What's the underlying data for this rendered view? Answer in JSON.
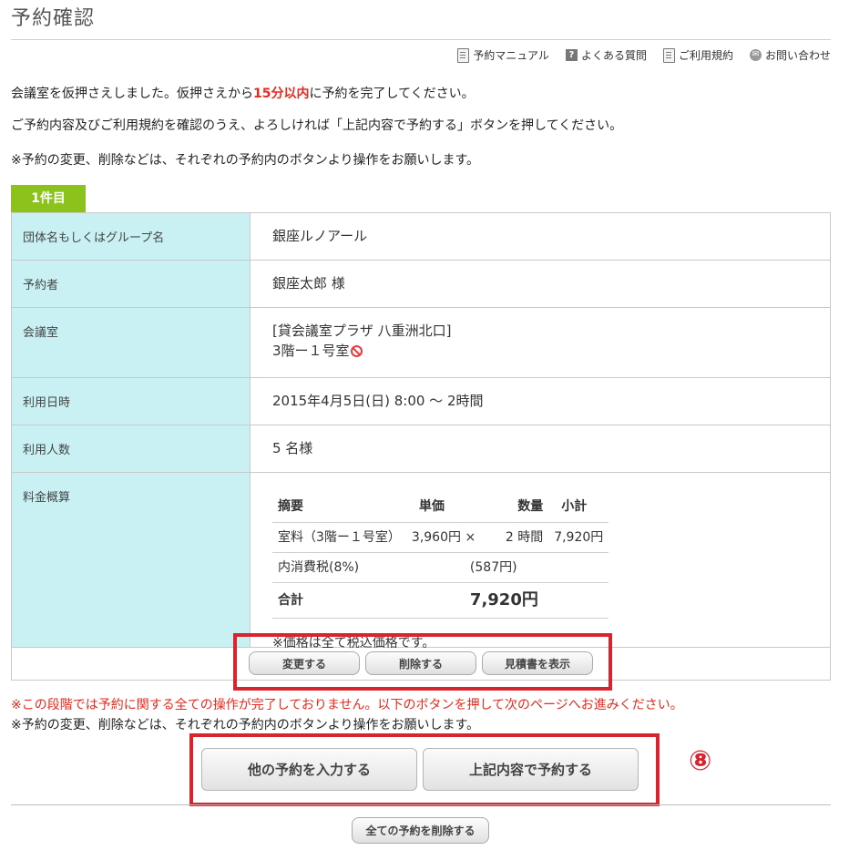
{
  "page_title": "予約確認",
  "help_links": [
    {
      "label": "予約マニュアル",
      "icon": "document-icon"
    },
    {
      "label": "よくある質問",
      "icon": "question-icon"
    },
    {
      "label": "ご利用規約",
      "icon": "document-icon"
    },
    {
      "label": "お問い合わせ",
      "icon": "mail-icon"
    }
  ],
  "messages": {
    "line1_a": "会議室を仮押さえしました。仮押さえから",
    "line1_em": "15分以内",
    "line1_b": "に予約を完了してください。",
    "line2": "ご予約内容及びご利用規約を確認のうえ、よろしければ「上記内容で予約する」ボタンを押してください。",
    "line3": "※予約の変更、削除などは、それぞれの予約内のボタンより操作をお願いします。"
  },
  "booking": {
    "tab": "1件目",
    "rows": {
      "group_label": "団体名もしくはグループ名",
      "group_value": "銀座ルノアール",
      "booker_label": "予約者",
      "booker_value": "銀座太郎 様",
      "room_label": "会議室",
      "room_value_line1": "[貸会議室プラザ 八重洲北口]",
      "room_value_line2": "3階ー１号室",
      "datetime_label": "利用日時",
      "datetime_value": "2015年4月5日(日) 8:00 ～ 2時間",
      "people_label": "利用人数",
      "people_value": "5 名様",
      "fee_label": "料金概算"
    },
    "fee": {
      "headers": {
        "item": "摘要",
        "unit": "単価",
        "qty": "数量",
        "subtotal": "小計"
      },
      "room_item": "室料（3階ー１号室）",
      "room_unit": "3,960円",
      "room_times": "×",
      "room_qty": "2 時間",
      "room_subtotal": "7,920円",
      "tax_item": "内消費税(8%)",
      "tax_value": "(587円)",
      "total_item": "合計",
      "total_value": "7,920円",
      "note": "※価格は全て税込価格です。"
    },
    "buttons": {
      "change": "変更する",
      "delete": "削除する",
      "estimate": "見積書を表示"
    }
  },
  "footer": {
    "red_note": "※この段階では予約に関する全ての操作が完了しておりません。以下のボタンを押して次のページへお進みください。",
    "black_note": "※予約の変更、削除などは、それぞれの予約内のボタンより操作をお願いします。",
    "other_booking_button": "他の予約を入力する",
    "confirm_button": "上記内容で予約する",
    "marker": "⑧",
    "delete_all_button": "全ての予約を削除する"
  },
  "colors": {
    "accent_green": "#8cc21c",
    "label_bg": "#c9f1f3",
    "alert_red": "#e8291d",
    "highlight": "#d8252d"
  }
}
